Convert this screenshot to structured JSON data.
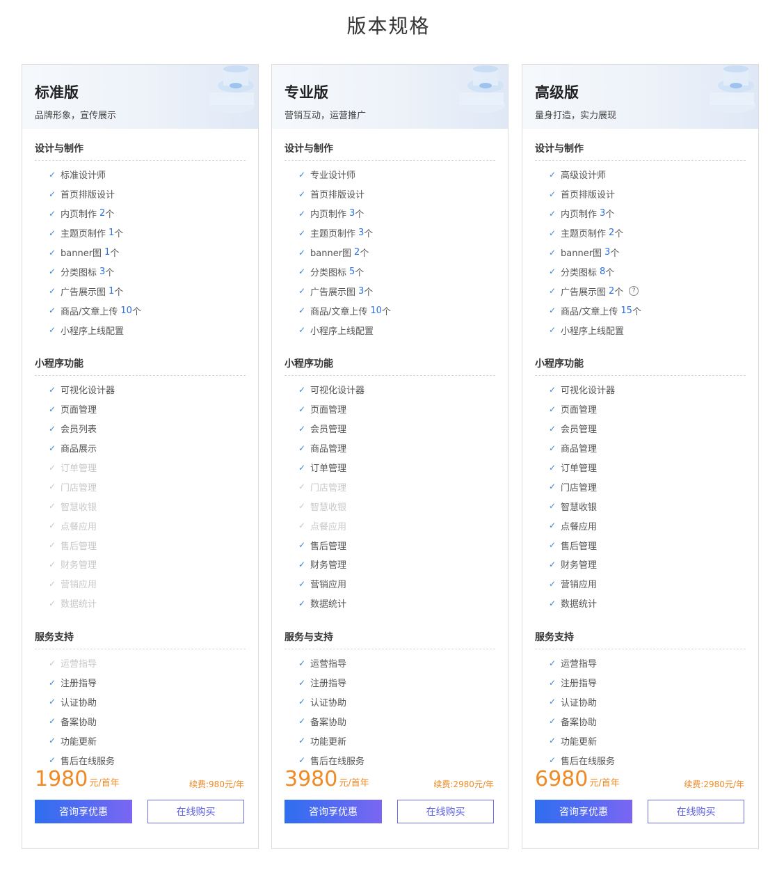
{
  "page": {
    "title": "版本规格"
  },
  "plans": [
    {
      "name": "标准版",
      "subtitle": "品牌形象，宣传展示",
      "sections": [
        {
          "title": "设计与制作",
          "items": [
            {
              "label": "标准设计师",
              "enabled": true
            },
            {
              "label": "首页排版设计",
              "enabled": true
            },
            {
              "label": "内页制作",
              "value": "2",
              "unit": "个",
              "enabled": true
            },
            {
              "label": "主题页制作",
              "value": "1",
              "unit": "个",
              "enabled": true
            },
            {
              "label": "banner图",
              "value": "1",
              "unit": "个",
              "enabled": true
            },
            {
              "label": "分类图标",
              "value": "3",
              "unit": "个",
              "enabled": true
            },
            {
              "label": "广告展示图",
              "value": "1",
              "unit": "个",
              "enabled": true
            },
            {
              "label": "商品/文章上传",
              "value": "10",
              "unit": "个",
              "enabled": true
            },
            {
              "label": "小程序上线配置",
              "enabled": true
            }
          ]
        },
        {
          "title": "小程序功能",
          "items": [
            {
              "label": "可视化设计器",
              "enabled": true
            },
            {
              "label": "页面管理",
              "enabled": true
            },
            {
              "label": "会员列表",
              "enabled": true
            },
            {
              "label": "商品展示",
              "enabled": true
            },
            {
              "label": "订单管理",
              "enabled": false
            },
            {
              "label": "门店管理",
              "enabled": false
            },
            {
              "label": "智慧收银",
              "enabled": false
            },
            {
              "label": "点餐应用",
              "enabled": false
            },
            {
              "label": "售后管理",
              "enabled": false
            },
            {
              "label": "财务管理",
              "enabled": false
            },
            {
              "label": "营销应用",
              "enabled": false
            },
            {
              "label": "数据统计",
              "enabled": false
            }
          ]
        },
        {
          "title": "服务支持",
          "items": [
            {
              "label": "运营指导",
              "enabled": false
            },
            {
              "label": "注册指导",
              "enabled": true
            },
            {
              "label": "认证协助",
              "enabled": true
            },
            {
              "label": "备案协助",
              "enabled": true
            },
            {
              "label": "功能更新",
              "enabled": true
            },
            {
              "label": "售后在线服务",
              "enabled": true
            }
          ]
        }
      ],
      "price": "1980",
      "price_unit": "元/首年",
      "renewal": "续费:980元/年",
      "consult_label": "咨询享优惠",
      "buy_label": "在线购买"
    },
    {
      "name": "专业版",
      "subtitle": "营销互动，运营推广",
      "sections": [
        {
          "title": "设计与制作",
          "items": [
            {
              "label": "专业设计师",
              "enabled": true
            },
            {
              "label": "首页排版设计",
              "enabled": true
            },
            {
              "label": "内页制作",
              "value": "3",
              "unit": "个",
              "enabled": true
            },
            {
              "label": "主题页制作",
              "value": "3",
              "unit": "个",
              "enabled": true
            },
            {
              "label": "banner图",
              "value": "2",
              "unit": "个",
              "enabled": true
            },
            {
              "label": "分类图标",
              "value": "5",
              "unit": "个",
              "enabled": true
            },
            {
              "label": "广告展示图",
              "value": "3",
              "unit": "个",
              "enabled": true
            },
            {
              "label": "商品/文章上传",
              "value": "10",
              "unit": "个",
              "enabled": true
            },
            {
              "label": "小程序上线配置",
              "enabled": true
            }
          ]
        },
        {
          "title": "小程序功能",
          "items": [
            {
              "label": "可视化设计器",
              "enabled": true
            },
            {
              "label": "页面管理",
              "enabled": true
            },
            {
              "label": "会员管理",
              "enabled": true
            },
            {
              "label": "商品管理",
              "enabled": true
            },
            {
              "label": "订单管理",
              "enabled": true
            },
            {
              "label": "门店管理",
              "enabled": false
            },
            {
              "label": "智慧收银",
              "enabled": false
            },
            {
              "label": "点餐应用",
              "enabled": false
            },
            {
              "label": "售后管理",
              "enabled": true
            },
            {
              "label": "财务管理",
              "enabled": true
            },
            {
              "label": "营销应用",
              "enabled": true
            },
            {
              "label": "数据统计",
              "enabled": true
            }
          ]
        },
        {
          "title": "服务与支持",
          "items": [
            {
              "label": "运营指导",
              "enabled": true
            },
            {
              "label": "注册指导",
              "enabled": true
            },
            {
              "label": "认证协助",
              "enabled": true
            },
            {
              "label": "备案协助",
              "enabled": true
            },
            {
              "label": "功能更新",
              "enabled": true
            },
            {
              "label": "售后在线服务",
              "enabled": true
            }
          ]
        }
      ],
      "price": "3980",
      "price_unit": "元/首年",
      "renewal": "续费:2980元/年",
      "consult_label": "咨询享优惠",
      "buy_label": "在线购买"
    },
    {
      "name": "高级版",
      "subtitle": "量身打造，实力展现",
      "sections": [
        {
          "title": "设计与制作",
          "items": [
            {
              "label": "高级设计师",
              "enabled": true
            },
            {
              "label": "首页排版设计",
              "enabled": true
            },
            {
              "label": "内页制作",
              "value": "3",
              "unit": "个",
              "enabled": true
            },
            {
              "label": "主题页制作",
              "value": "2",
              "unit": "个",
              "enabled": true
            },
            {
              "label": "banner图",
              "value": "3",
              "unit": "个",
              "enabled": true
            },
            {
              "label": "分类图标",
              "value": "8",
              "unit": "个",
              "enabled": true
            },
            {
              "label": "广告展示图",
              "value": "2",
              "unit": "个",
              "enabled": true,
              "help": "?"
            },
            {
              "label": "商品/文章上传",
              "value": "15",
              "unit": "个",
              "enabled": true
            },
            {
              "label": "小程序上线配置",
              "enabled": true
            }
          ]
        },
        {
          "title": "小程序功能",
          "items": [
            {
              "label": "可视化设计器",
              "enabled": true
            },
            {
              "label": "页面管理",
              "enabled": true
            },
            {
              "label": "会员管理",
              "enabled": true
            },
            {
              "label": "商品管理",
              "enabled": true
            },
            {
              "label": "订单管理",
              "enabled": true
            },
            {
              "label": "门店管理",
              "enabled": true
            },
            {
              "label": "智慧收银",
              "enabled": true
            },
            {
              "label": "点餐应用",
              "enabled": true
            },
            {
              "label": "售后管理",
              "enabled": true
            },
            {
              "label": "财务管理",
              "enabled": true
            },
            {
              "label": "营销应用",
              "enabled": true
            },
            {
              "label": "数据统计",
              "enabled": true
            }
          ]
        },
        {
          "title": "服务支持",
          "items": [
            {
              "label": "运营指导",
              "enabled": true
            },
            {
              "label": "注册指导",
              "enabled": true
            },
            {
              "label": "认证协助",
              "enabled": true
            },
            {
              "label": "备案协助",
              "enabled": true
            },
            {
              "label": "功能更新",
              "enabled": true
            },
            {
              "label": "售后在线服务",
              "enabled": true
            }
          ]
        }
      ],
      "price": "6980",
      "price_unit": "元/首年",
      "renewal": "续费:2980元/年",
      "consult_label": "咨询享优惠",
      "buy_label": "在线购买"
    }
  ],
  "icons": {
    "check": "check-icon",
    "help": "question-circle-icon"
  },
  "colors": {
    "accent": "#2d6fe0",
    "check": "#3a86d8",
    "price": "#f08a24",
    "disabled": "#c8c8c8",
    "button_start": "#2f6ef0",
    "button_end": "#7b66f2"
  }
}
